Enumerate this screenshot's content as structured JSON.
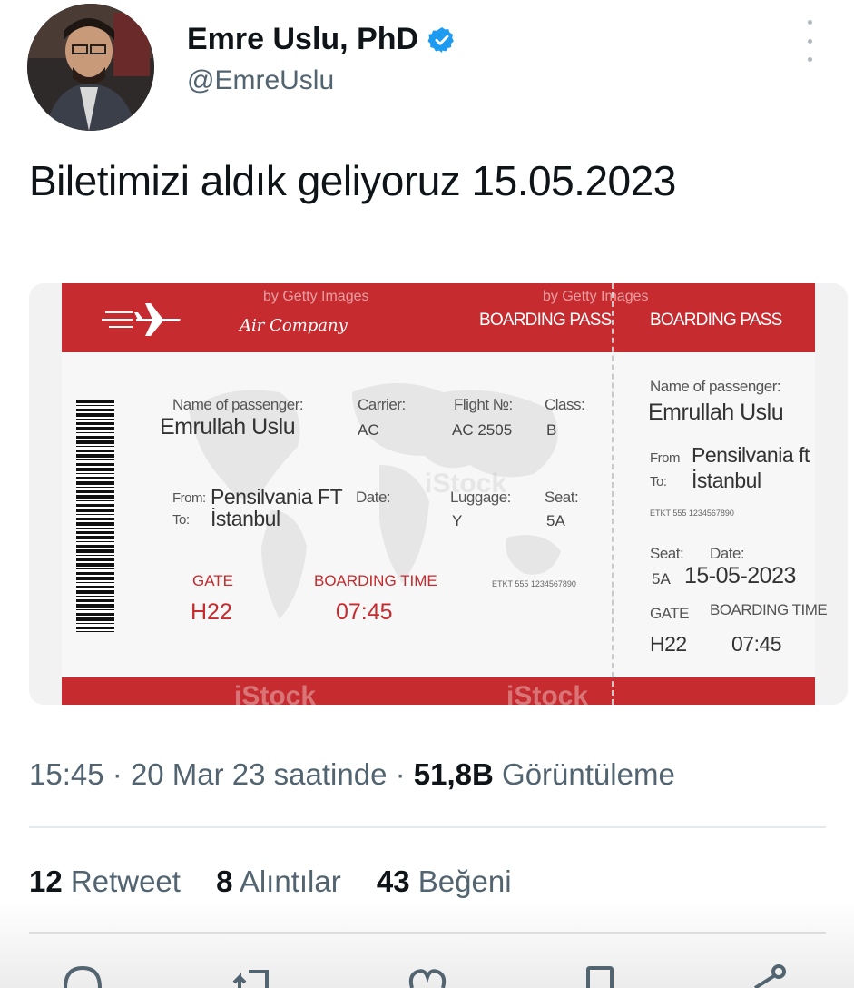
{
  "author": {
    "display_name": "Emre Uslu, PhD",
    "handle": "@EmreUslu",
    "verified_icon": "verified-badge-icon",
    "verified_color": "#1d9bf0"
  },
  "tweet": {
    "text": "Biletimizi aldık geliyoruz 15.05.2023"
  },
  "media": {
    "type": "boarding-pass-image",
    "watermarks": [
      "by Getty Images",
      "by Getty Images",
      "iStock",
      "iStock",
      "iStock"
    ],
    "airline": "Air Company",
    "header_label_main": "BOARDING PASS",
    "header_label_stub": "BOARDING PASS",
    "main": {
      "name_label": "Name of passenger:",
      "name_value": "Emrullah Uslu",
      "carrier_label": "Carrier:",
      "carrier_value": "AC",
      "flight_label": "Flight №:",
      "flight_value": "AC 2505",
      "class_label": "Class:",
      "class_value": "B",
      "from_label": "From:",
      "from_value": "Pensilvania FT",
      "to_label": "To:",
      "to_value": "İstanbul",
      "date_label": "Date:",
      "luggage_label": "Luggage:",
      "luggage_value": "Y",
      "seat_label": "Seat:",
      "seat_value": "5A",
      "etkt": "ETKT 555 1234567890",
      "gate_label": "GATE",
      "gate_value": "H22",
      "boarding_label": "BOARDING TIME",
      "boarding_value": "07:45"
    },
    "stub": {
      "name_label": "Name of passenger:",
      "name_value": "Emrullah Uslu",
      "from_label": "From",
      "from_value": "Pensilvania ft",
      "to_label": "To:",
      "to_value": "İstanbul",
      "etkt": "ETKT 555 1234567890",
      "seat_label": "Seat:",
      "seat_value": "5A",
      "date_label": "Date:",
      "date_value": "15-05-2023",
      "gate_label": "GATE",
      "gate_value": "H22",
      "boarding_label": "BOARDING TIME",
      "boarding_value": "07:45"
    },
    "colors": {
      "ticket_red": "#c52b2f"
    }
  },
  "meta": {
    "time": "15:45",
    "date": "20 Mar 23 saatinde",
    "views_count": "51,8B",
    "views_label": "Görüntüleme"
  },
  "stats": {
    "retweets_count": "12",
    "retweets_label": "Retweet",
    "quotes_count": "8",
    "quotes_label": "Alıntılar",
    "likes_count": "43",
    "likes_label": "Beğeni"
  },
  "actions": [
    "reply-icon",
    "retweet-icon",
    "like-icon",
    "bookmark-icon",
    "share-icon"
  ]
}
